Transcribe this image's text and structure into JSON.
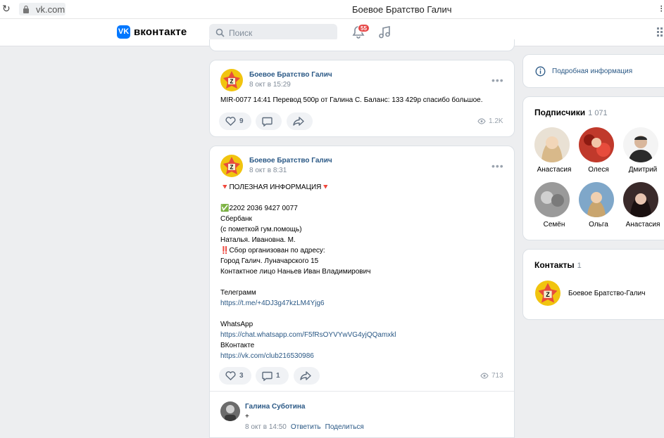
{
  "browser": {
    "url": "vk.com",
    "tab_title": "Боевое Братство Галич"
  },
  "header": {
    "logo_text": "вконтакте",
    "search_placeholder": "Поиск",
    "notifications_count": "55",
    "accent": "#0077ff"
  },
  "posts": [
    {
      "author": "Боевое Братство Галич",
      "date": "8 окт в 15:29",
      "text_lines": [
        "MIR-0077 14:41 Перевод 500р от Галина С. Баланс: 133 429р спасибо большое."
      ],
      "likes": "9",
      "comments": "",
      "views": "1.2K"
    },
    {
      "author": "Боевое Братство Галич",
      "date": "8 окт в 8:31",
      "text_lines": [
        "🔻ПОЛЕЗНАЯ ИНФОРМАЦИЯ🔻",
        "",
        "✅2202 2036 9427 0077",
        "Сбербанк",
        "(с пометкой гум.помощь)",
        "Наталья. Ивановна. М.",
        "‼️Сбор организован по адресу:",
        "Город Галич. Луначарского 15",
        "Контактное лицо Наньев Иван Владимирович",
        "",
        "Телеграмм",
        "https://t.me/+4DJ3g47kzLM4Yjg6",
        "",
        "WhatsApp",
        "https://chat.whatsapp.com/F5fRsOYVYwVG4yjQQamxkl",
        "ВКонтакте",
        "https://vk.com/club216530986"
      ],
      "likes": "3",
      "comments": "1",
      "views": "713",
      "comment": {
        "author": "Галина Суботина",
        "text": "+",
        "date": "8 окт в 14:50",
        "reply": "Ответить",
        "share": "Поделиться"
      }
    }
  ],
  "sidebar": {
    "info_link": "Подробная информация",
    "subscribers_title": "Подписчики",
    "subscribers_count": "1 071",
    "subscribers": [
      {
        "name": "Анастасия",
        "color": "#d8b98a"
      },
      {
        "name": "Олеся",
        "color": "#c0392b"
      },
      {
        "name": "Дмитрий",
        "color": "#2b2b2b"
      },
      {
        "name": "Семён",
        "color": "#8a8a8a"
      },
      {
        "name": "Ольга",
        "color": "#7fa7c9"
      },
      {
        "name": "Анастасия",
        "color": "#3a2a2a"
      }
    ],
    "contacts_title": "Контакты",
    "contacts_count": "1",
    "contact_name": "Боевое Братство-Галич"
  }
}
